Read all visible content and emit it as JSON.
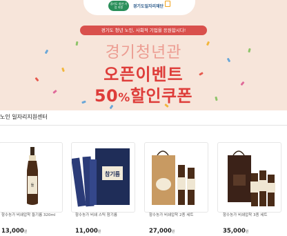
{
  "banner": {
    "logo_mark_text": "경기도 청년 기업 지원",
    "logo_text": "경기도일자리재단",
    "tagline": "경기도 청년 노인, 사회적 기업을 응원합시다!",
    "title_line1": "경기청년관",
    "title_line2": "오픈이벤트",
    "title_line3_num": "50",
    "title_line3_pct": "%",
    "title_line3_rest": "할인쿠폰",
    "colors": {
      "background": "#f7e5da",
      "accent": "#de3d3a",
      "soft": "#ec9d92",
      "tag_bg": "#d9504c"
    }
  },
  "section": {
    "title": "노인 일자리지원센터"
  },
  "products": [
    {
      "name": "항수농가 비쇄압착 들기름 320ml",
      "price": "13,000",
      "currency": "원",
      "icon": "sesame-oil-bottle-icon"
    },
    {
      "name": "항수농가 비쇄 스틱 참기름",
      "price": "11,000",
      "currency": "원",
      "icon": "oil-stick-box-icon"
    },
    {
      "name": "항수농가 비쇄압착 2종 세트",
      "price": "27,000",
      "currency": "원",
      "icon": "gift-set-icon"
    },
    {
      "name": "항수농가 비쇄압착 3종 세트",
      "price": "35,000",
      "currency": "원",
      "icon": "gift-set-3-icon"
    }
  ]
}
